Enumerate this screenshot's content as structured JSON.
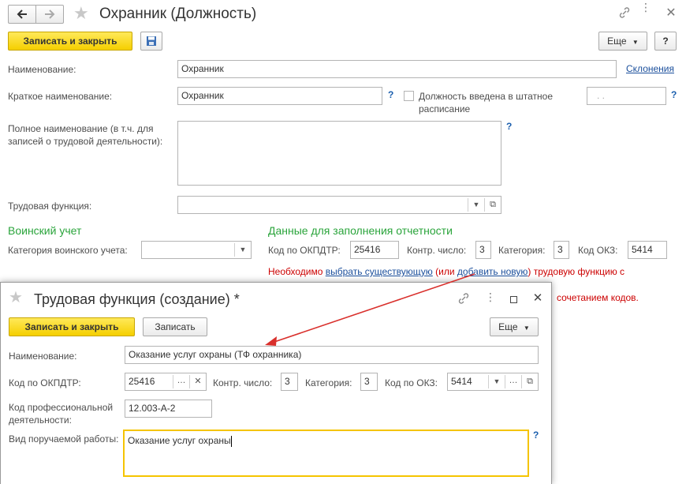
{
  "main": {
    "title": "Охранник (Должность)",
    "toolbar": {
      "save_close": "Записать и закрыть",
      "more": "Еще",
      "help": "?"
    },
    "fields": {
      "name_label": "Наименование:",
      "name_value": "Охранник",
      "declensions_link": "Склонения",
      "short_name_label": "Краткое наименование:",
      "short_name_value": "Охранник",
      "staffing_checkbox_label": "Должность введена в штатное расписание",
      "staffing_date_placeholder": ".   .",
      "full_name_label": "Полное наименование (в т.ч. для записей о трудовой деятельности):",
      "full_name_value": "",
      "labor_function_label": "Трудовая функция:",
      "labor_function_value": ""
    },
    "military": {
      "heading": "Воинский учет",
      "category_label": "Категория воинского учета:",
      "category_value": ""
    },
    "reporting": {
      "heading": "Данные для заполнения отчетности",
      "okpdtr_label": "Код по ОКПДТР:",
      "okpdtr_value": "25416",
      "control_label": "Контр. число:",
      "control_value": "3",
      "category_label": "Категория:",
      "category_value": "3",
      "okz_label": "Код ОКЗ:",
      "okz_value": "5414"
    },
    "warning": {
      "part1": "Необходимо ",
      "link1": "выбрать существующую",
      "part2": " (или ",
      "link2": "добавить новую",
      "part3": ") трудовую функцию с",
      "part4": "сочетанием кодов."
    },
    "help_mark": "?",
    "colors": {
      "accent_yellow": "#f5cf00",
      "heading_green": "#2aa43b",
      "warning_red": "#cc0000",
      "link_blue": "#1b4f9c",
      "arrow_red": "#d9302c"
    }
  },
  "dialog": {
    "title": "Трудовая функция (создание) *",
    "toolbar": {
      "save_close": "Записать и закрыть",
      "save": "Записать",
      "more": "Еще"
    },
    "fields": {
      "name_label": "Наименование:",
      "name_value": "Оказание услуг охраны (ТФ охранника)",
      "okpdtr_label": "Код по ОКПДТР:",
      "okpdtr_value": "25416",
      "control_label": "Контр. число:",
      "control_value": "3",
      "category_label": "Категория:",
      "category_value": "3",
      "okz_label": "Код по ОКЗ:",
      "okz_value": "5414",
      "prof_code_label": "Код профессиональной деятельности:",
      "prof_code_value": "12.003-A-2",
      "work_type_label": "Вид поручаемой работы:",
      "work_type_value": "Оказание услуг охраны"
    },
    "help_mark": "?"
  }
}
